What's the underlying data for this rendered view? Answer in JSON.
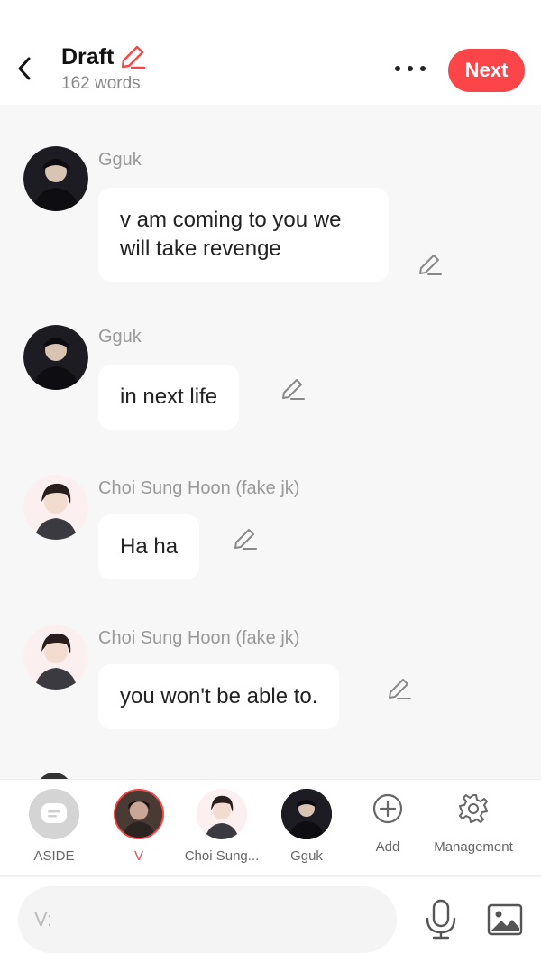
{
  "header": {
    "back_icon": "chevron-left-icon",
    "title": "Draft",
    "title_edit_icon": "pencil-icon",
    "word_count": "162 words",
    "more_icon": "more-horizontal-icon",
    "next_label": "Next",
    "accent_color": "#fb4548"
  },
  "messages": [
    {
      "author": "Gguk",
      "avatar_icon": "avatar-gguk",
      "text": "v am coming to you we will take revenge",
      "edit_icon": "pencil-icon"
    },
    {
      "author": "Gguk",
      "avatar_icon": "avatar-gguk",
      "text": "in next life",
      "edit_icon": "pencil-icon"
    },
    {
      "author": "Choi Sung Hoon (fake jk)",
      "avatar_icon": "avatar-choi-sung-hoon",
      "text": "Ha ha",
      "edit_icon": "pencil-icon"
    },
    {
      "author": "Choi Sung Hoon (fake jk)",
      "avatar_icon": "avatar-choi-sung-hoon",
      "text": "you won't be able to.",
      "edit_icon": "pencil-icon"
    }
  ],
  "characters": [
    {
      "label": "ASIDE",
      "icon": "aside-icon",
      "selected": false
    },
    {
      "label": "V",
      "icon": "avatar-v",
      "selected": true
    },
    {
      "label": "Choi Sung...",
      "icon": "avatar-choi-sung-hoon",
      "selected": false
    },
    {
      "label": "Gguk",
      "icon": "avatar-gguk",
      "selected": false
    },
    {
      "label": "Add",
      "icon": "plus-circle-icon",
      "selected": false
    },
    {
      "label": "Management",
      "icon": "gear-icon",
      "selected": false
    }
  ],
  "composer": {
    "placeholder": "V:",
    "mic_icon": "microphone-icon",
    "image_icon": "image-icon"
  }
}
